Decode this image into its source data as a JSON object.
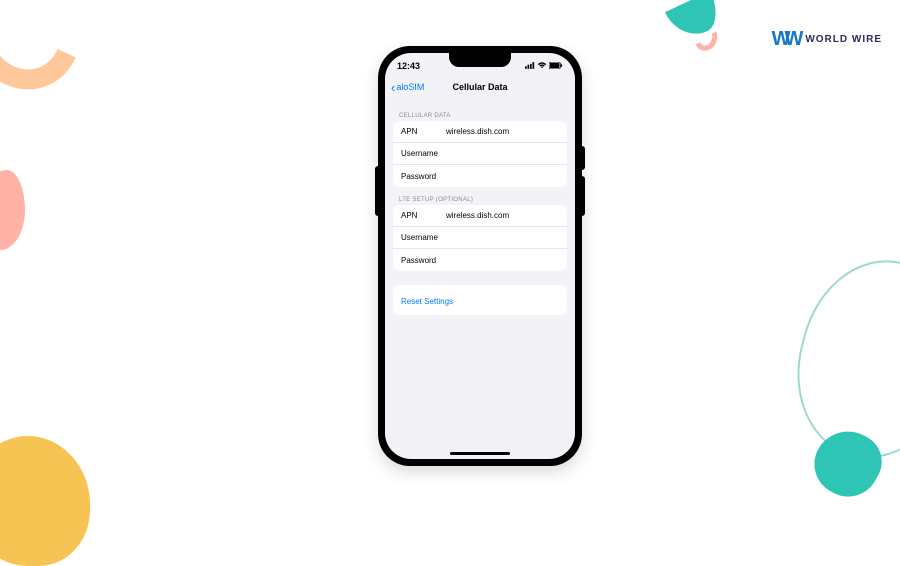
{
  "brand": {
    "icon_text": "WW",
    "label": "WORLD WIRE"
  },
  "status": {
    "time": "12:43"
  },
  "nav": {
    "back_label": "aloSIM",
    "title": "Cellular Data"
  },
  "sections": {
    "cellular": {
      "header": "CELLULAR DATA",
      "apn_label": "APN",
      "apn_value": "wireless.dish.com",
      "username_label": "Username",
      "username_value": "",
      "password_label": "Password",
      "password_value": ""
    },
    "lte": {
      "header": "LTE SETUP (OPTIONAL)",
      "apn_label": "APN",
      "apn_value": "wireless.dish.com",
      "username_label": "Username",
      "username_value": "",
      "password_label": "Password",
      "password_value": ""
    }
  },
  "reset": {
    "label": "Reset Settings"
  }
}
